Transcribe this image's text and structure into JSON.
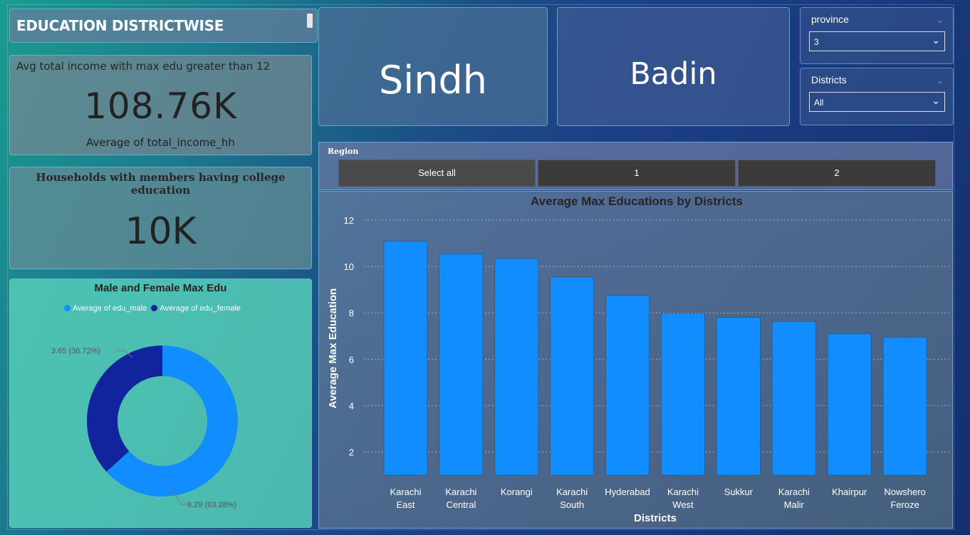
{
  "title": "EDUCATION DISTRICTWISE",
  "kpi_income": {
    "caption": "Avg total income with max edu greater than 12",
    "value": "108.76K",
    "sub": "Average of total_income_hh"
  },
  "kpi_college": {
    "caption": "Households with members having college education",
    "value": "10K"
  },
  "province_card": "Sindh",
  "district_card": "Badin",
  "province_slicer": {
    "label": "province",
    "value": "3"
  },
  "districts_slicer": {
    "label": "Districts",
    "value": "All"
  },
  "region": {
    "label": "Region",
    "buttons": [
      "Select all",
      "1",
      "2"
    ]
  },
  "colors": {
    "male": "#118dff",
    "female": "#12239e",
    "bar": "#118dff"
  },
  "donut": {
    "title": "Male and Female Max Edu",
    "legend_male": "Average of edu_male",
    "legend_female": "Average of edu_female",
    "label_female": "3.65 (36.72%)",
    "label_male": "6.29 (63.28%)"
  },
  "chart_data": [
    {
      "type": "bar",
      "title": "Average Max Educations by Districts",
      "xlabel": "Districts",
      "ylabel": "Average Max Education",
      "categories": [
        "Karachi East",
        "Karachi Central",
        "Korangi",
        "Karachi South",
        "Hyderabad",
        "Karachi West",
        "Sukkur",
        "Karachi Malir",
        "Khairpur",
        "Nowshero Feroze"
      ],
      "values": [
        11.1,
        10.55,
        10.35,
        9.55,
        8.75,
        7.98,
        7.8,
        7.63,
        7.1,
        6.95
      ],
      "yticks": [
        2,
        4,
        6,
        8,
        10,
        12
      ],
      "ylim": [
        1,
        12.5
      ],
      "grid": true
    },
    {
      "type": "pie",
      "title": "Male and Female Max Edu",
      "categories": [
        "Average of edu_male",
        "Average of edu_female"
      ],
      "values": [
        6.29,
        3.65
      ],
      "percent": [
        63.28,
        36.72
      ]
    }
  ]
}
